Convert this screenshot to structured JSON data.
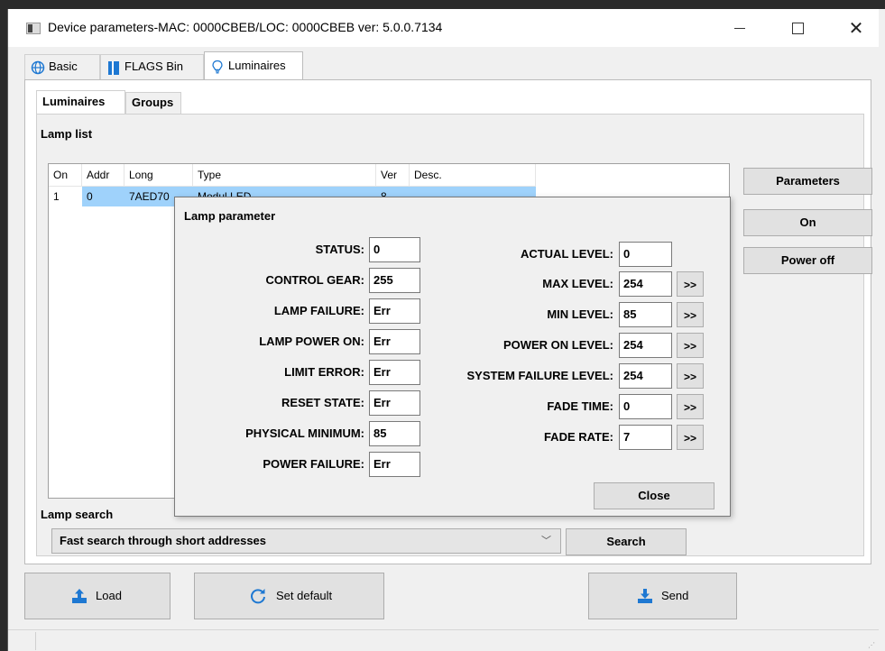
{
  "window": {
    "title": "Device parameters-MAC: 0000CBEB/LOC: 0000CBEB ver: 5.0.0.7134",
    "minimize": "—",
    "maximize": "",
    "close": "✕"
  },
  "main_tabs": [
    {
      "label": "Basic",
      "icon": "globe-icon"
    },
    {
      "label": "FLAGS Bin",
      "icon": "flag-icon"
    },
    {
      "label": "Luminaires",
      "icon": "lightbulb-icon",
      "active": true
    }
  ],
  "sub_tabs": [
    {
      "label": "Luminaires",
      "active": true
    },
    {
      "label": "Groups"
    }
  ],
  "lamp_list": {
    "label": "Lamp list",
    "columns": [
      "On",
      "Addr",
      "Long",
      "Type",
      "Ver",
      "Desc."
    ],
    "rows": [
      {
        "on": "1",
        "addr": "0",
        "long": "7AED70",
        "type": "Modul LED",
        "ver": "8",
        "desc": ""
      }
    ]
  },
  "right_buttons": {
    "parameters": "Parameters",
    "on": "On",
    "power_off": "Power off"
  },
  "lamp_search": {
    "label": "Lamp search",
    "selected": "Fast search through short addresses",
    "search_button": "Search"
  },
  "bottom_buttons": {
    "load": "Load",
    "set_default": "Set default",
    "send": "Send"
  },
  "dialog": {
    "title": "Lamp parameter",
    "left": [
      {
        "label": "STATUS:",
        "value": "0"
      },
      {
        "label": "CONTROL GEAR:",
        "value": "255"
      },
      {
        "label": "LAMP FAILURE:",
        "value": "Err"
      },
      {
        "label": "LAMP POWER ON:",
        "value": "Err"
      },
      {
        "label": "LIMIT ERROR:",
        "value": "Err"
      },
      {
        "label": "RESET STATE:",
        "value": "Err"
      },
      {
        "label": "PHYSICAL MINIMUM:",
        "value": "85"
      },
      {
        "label": "POWER FAILURE:",
        "value": "Err"
      }
    ],
    "right": [
      {
        "label": "ACTUAL LEVEL:",
        "value": "0"
      },
      {
        "label": "MAX LEVEL:",
        "value": "254",
        "button": ">>"
      },
      {
        "label": "MIN LEVEL:",
        "value": "85",
        "button": ">>"
      },
      {
        "label": "POWER ON LEVEL:",
        "value": "254",
        "button": ">>"
      },
      {
        "label": "SYSTEM FAILURE LEVEL:",
        "value": "254",
        "button": ">>"
      },
      {
        "label": "FADE TIME:",
        "value": "0",
        "button": ">>"
      },
      {
        "label": "FADE RATE:",
        "value": "7",
        "button": ">>"
      }
    ],
    "close_button": "Close"
  },
  "colors": {
    "selection": "#9fd2fb",
    "accent_blue": "#1e78d2"
  }
}
